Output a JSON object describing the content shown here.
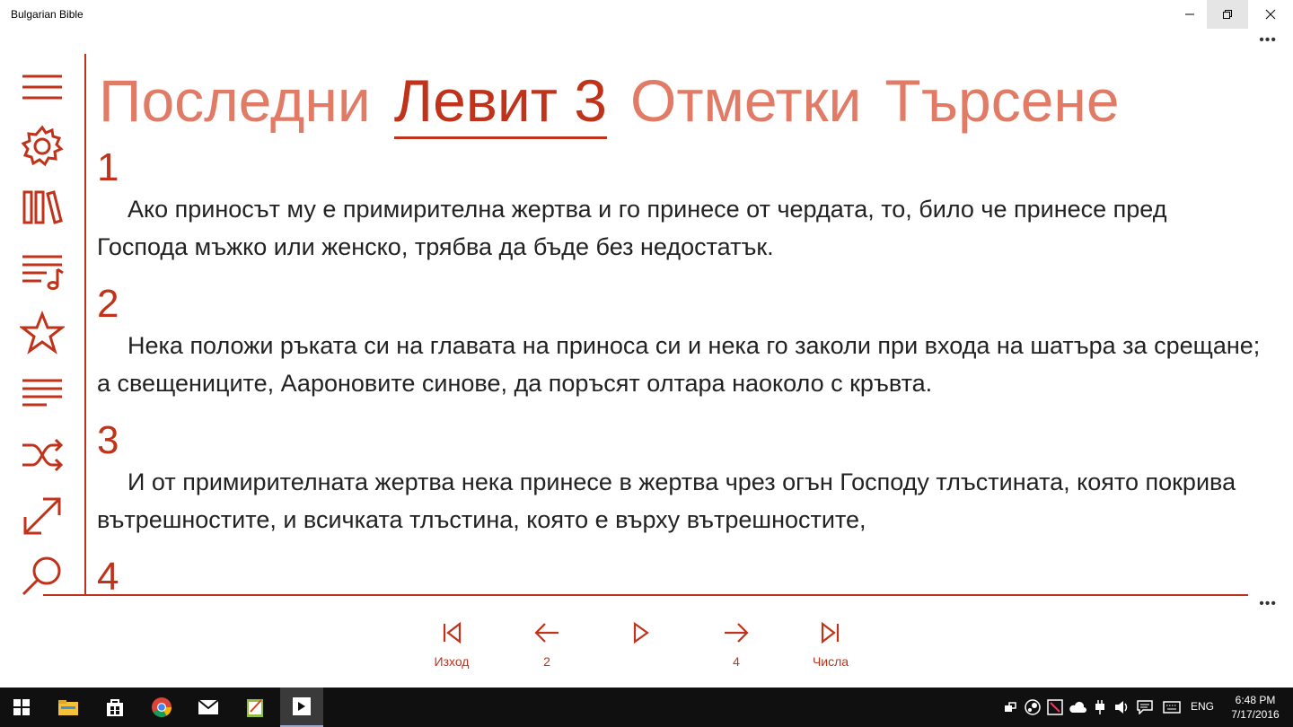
{
  "window": {
    "title": "Bulgarian Bible"
  },
  "pivot": {
    "tabs": [
      {
        "label": "Последни"
      },
      {
        "label": "Левит 3"
      },
      {
        "label": "Отметки"
      },
      {
        "label": "Търсене"
      }
    ],
    "active_index": 1
  },
  "verses": [
    {
      "num": "1",
      "text": "Ако приносът му е примирителна жертва и го принесе от чердата, то, било че принесе пред Господа мъжко или женско, трябва да бъде без недостатък."
    },
    {
      "num": "2",
      "text": "Нека положи ръката си на главата на приноса си и нека го заколи при входа на шатъра за срещане; а свещениците, Аароновите синове, да поръсят олтара наоколо с кръвта."
    },
    {
      "num": "3",
      "text": "И от примирителната жертва нека принесе в жертва чрез огън Господу тлъстината, която покрива вътрешностите, и всичката тлъстина, която е върху вътрешностите,"
    },
    {
      "num": "4",
      "text": ""
    }
  ],
  "appbar": {
    "buttons": [
      {
        "label": "Изход"
      },
      {
        "label": "2"
      },
      {
        "label": ""
      },
      {
        "label": "4"
      },
      {
        "label": "Числа"
      }
    ]
  },
  "rail_icons": [
    "hamburger-menu-icon",
    "gear-icon",
    "library-icon",
    "playlist-icon",
    "star-icon",
    "text-lines-icon",
    "shuffle-icon",
    "resize-arrow-icon",
    "search-icon"
  ],
  "taskbar": {
    "language": "ENG",
    "time": "6:48 PM",
    "date": "7/17/2016"
  },
  "colors": {
    "accent": "#c0321a",
    "accent_light": "#e17b66",
    "text": "#222222"
  }
}
